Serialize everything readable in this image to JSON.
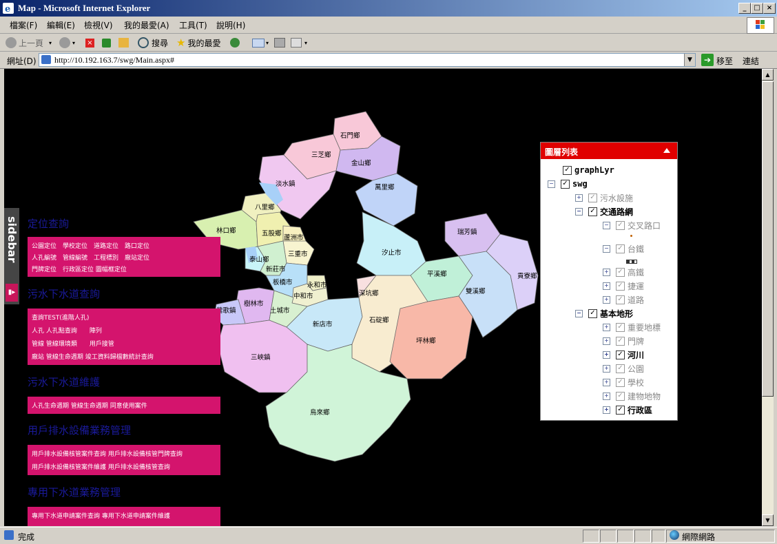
{
  "window": {
    "title": "Map - Microsoft Internet Explorer"
  },
  "menu": [
    "檔案(F)",
    "編輯(E)",
    "檢視(V)",
    "我的最愛(A)",
    "工具(T)",
    "說明(H)"
  ],
  "toolbar": {
    "back": "上一頁",
    "search": "搜尋",
    "favorites": "我的最愛"
  },
  "address": {
    "label": "網址(D)",
    "url": "http://10.192.163.7/swg/Main.aspx#",
    "go": "移至",
    "links": "連結"
  },
  "status": {
    "text": "完成",
    "zone": "網際網路"
  },
  "sidebar": {
    "tab_label": "sidebar",
    "sections": [
      {
        "title": "定位查詢",
        "rows": [
          "公園定位　學校定位　道路定位　路口定位",
          "人孔編號　管線編號　工程標別　廠站定位",
          "門牌定位　行政區定位 圖幅框定位"
        ]
      },
      {
        "title": "污水下水道查詢",
        "rows": [
          "查詢TEST(進階人孔)",
          "人孔 人孔點查詢　　陣列",
          "管線 管線環境類　　用戶接管",
          "廠站 管線生命週期 竣工資料歸檔數統計查詢"
        ]
      },
      {
        "title": "污水下水道維護",
        "rows": [
          "人孔生命週期 管線生命週期 同意使用案件"
        ]
      },
      {
        "title": "用戶排水設備業務管理",
        "rows": [
          "用戶排水設備核管案件查詢 用戶排水設備核管門牌查詢",
          "用戶排水設備核管案件維護 用戶排水設備核管查詢"
        ]
      },
      {
        "title": "專用下水道業務管理",
        "rows": [
          "專用下水道申請案件查詢 專用下水道申請案件維護"
        ]
      }
    ]
  },
  "map": {
    "districts": [
      "石門鄉",
      "三芝鄉",
      "金山鄉",
      "淡水鎮",
      "萬里鄉",
      "八里鄉",
      "林口鄉",
      "五股鄉",
      "蘆洲市",
      "三重市",
      "泰山鄉",
      "新莊市",
      "汐止市",
      "瑞芳鎮",
      "平溪鄉",
      "板橋市",
      "永和市",
      "中和市",
      "深坑鄉",
      "貢寮鄉",
      "雙溪鄉",
      "樹林市",
      "土城市",
      "鶯歌鎮",
      "新店市",
      "石碇鄉",
      "坪林鄉",
      "三峽鎮",
      "烏來鄉"
    ]
  },
  "layers": {
    "title": "圖層列表",
    "items": [
      {
        "label": "graphLyr",
        "level": 0,
        "checked": true,
        "enabled": true,
        "bold": false,
        "expander": ""
      },
      {
        "label": "swg",
        "level": 0,
        "checked": true,
        "enabled": true,
        "bold": false,
        "expander": "minus"
      },
      {
        "label": "污水設施",
        "level": 1,
        "checked": true,
        "enabled": false,
        "bold": false,
        "expander": "plus"
      },
      {
        "label": "交通路網",
        "level": 1,
        "checked": true,
        "enabled": true,
        "bold": true,
        "expander": "minus"
      },
      {
        "label": "交叉路口",
        "level": 2,
        "checked": true,
        "enabled": false,
        "bold": false,
        "expander": "minus"
      },
      {
        "label": "台鐵",
        "level": 2,
        "checked": true,
        "enabled": false,
        "bold": false,
        "expander": "minus"
      },
      {
        "label": "高鐵",
        "level": 2,
        "checked": true,
        "enabled": false,
        "bold": false,
        "expander": "plus"
      },
      {
        "label": "捷運",
        "level": 2,
        "checked": true,
        "enabled": false,
        "bold": false,
        "expander": "plus"
      },
      {
        "label": "道路",
        "level": 2,
        "checked": true,
        "enabled": false,
        "bold": false,
        "expander": "plus"
      },
      {
        "label": "基本地形",
        "level": 1,
        "checked": true,
        "enabled": true,
        "bold": true,
        "expander": "minus"
      },
      {
        "label": "重要地標",
        "level": 2,
        "checked": true,
        "enabled": false,
        "bold": false,
        "expander": "plus"
      },
      {
        "label": "門牌",
        "level": 2,
        "checked": true,
        "enabled": false,
        "bold": false,
        "expander": "plus"
      },
      {
        "label": "河川",
        "level": 2,
        "checked": true,
        "enabled": true,
        "bold": true,
        "expander": "plus"
      },
      {
        "label": "公園",
        "level": 2,
        "checked": true,
        "enabled": false,
        "bold": false,
        "expander": "plus"
      },
      {
        "label": "學校",
        "level": 2,
        "checked": true,
        "enabled": false,
        "bold": false,
        "expander": "plus"
      },
      {
        "label": "建物地物",
        "level": 2,
        "checked": true,
        "enabled": false,
        "bold": false,
        "expander": "plus"
      },
      {
        "label": "行政區",
        "level": 2,
        "checked": true,
        "enabled": true,
        "bold": true,
        "expander": "plus"
      }
    ]
  },
  "colors": {
    "accent_pink": "#d4146d",
    "title_blue": "#1a1a9a",
    "panel_red": "#e00000"
  }
}
